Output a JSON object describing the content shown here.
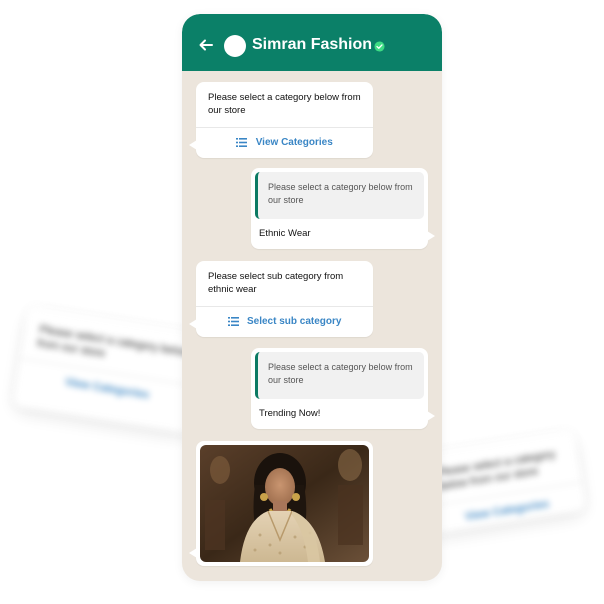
{
  "header": {
    "contact_name": "Simran Fashion",
    "bg_color": "#0b8068",
    "verified": true
  },
  "background_cards": {
    "left": {
      "text": "Please select a category below from our store",
      "link": "View Categories"
    },
    "right": {
      "text": "Please select a category below from our store",
      "link": "View Categories"
    }
  },
  "messages": [
    {
      "direction": "incoming",
      "text": "Please select a category below from our store",
      "action_label": "View Categories",
      "action_icon": "list-icon"
    },
    {
      "direction": "outgoing",
      "quoted_text": "Please select a category below from our store",
      "text": "Ethnic Wear"
    },
    {
      "direction": "incoming",
      "text": "Please select sub category from ethnic wear",
      "action_label": "Select sub category",
      "action_icon": "list-icon"
    },
    {
      "direction": "outgoing",
      "quoted_text": "Please select a category below from our store",
      "text": "Trending Now!"
    },
    {
      "direction": "incoming",
      "type": "image",
      "image": "product-photo"
    }
  ],
  "colors": {
    "accent_green": "#0b8068",
    "link_blue": "#3a86c5",
    "chat_bg": "#ece5dc"
  }
}
